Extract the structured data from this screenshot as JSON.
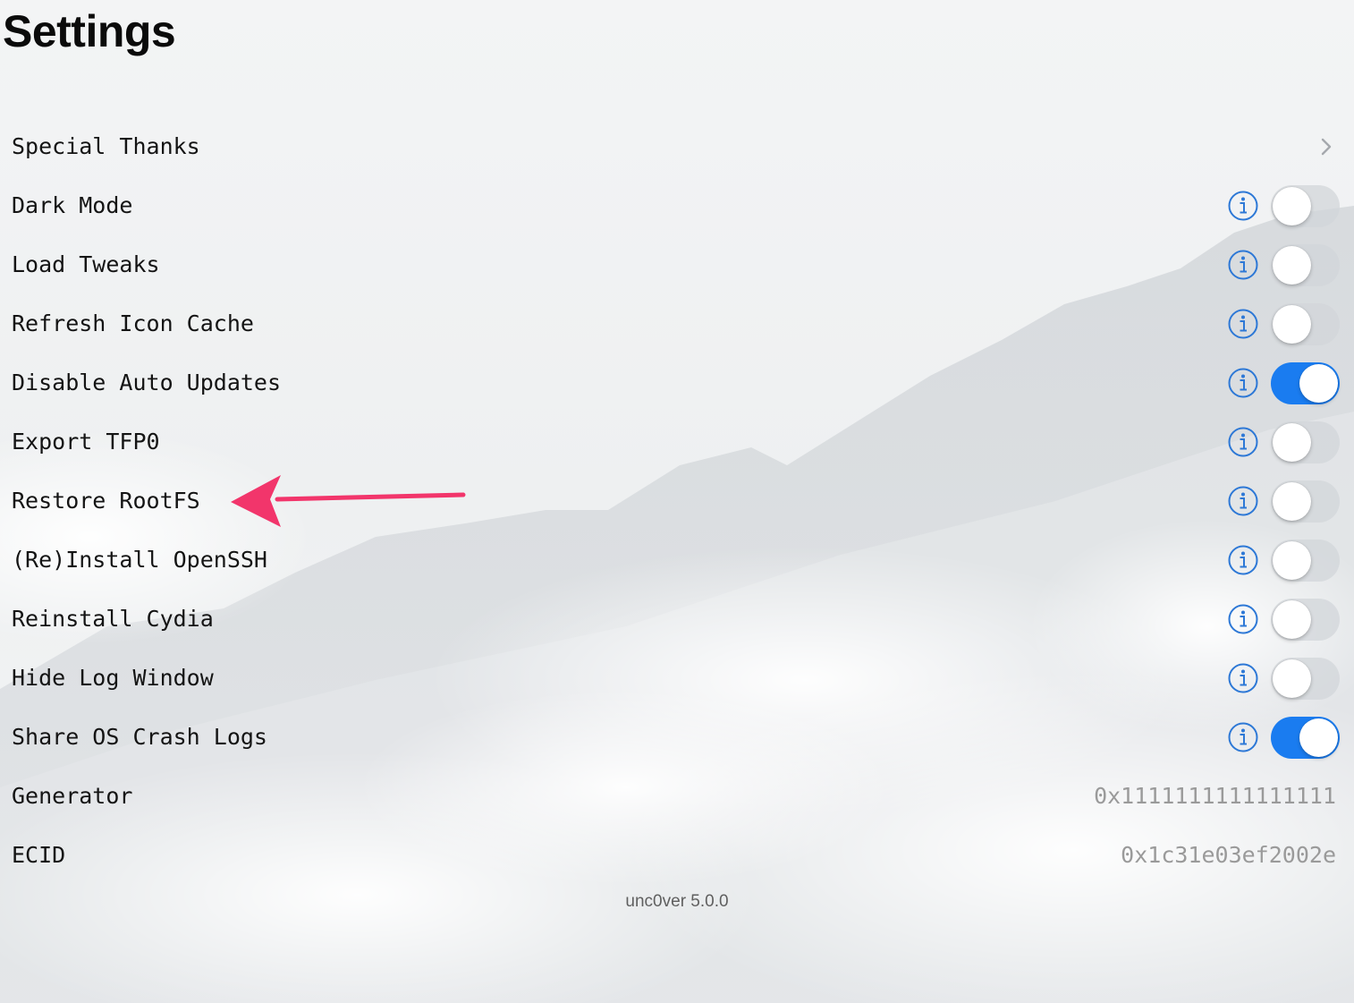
{
  "page": {
    "title": "Settings"
  },
  "settings": {
    "special_thanks": {
      "label": "Special Thanks"
    },
    "toggles": [
      {
        "label": "Dark Mode",
        "on": false
      },
      {
        "label": "Load Tweaks",
        "on": false
      },
      {
        "label": "Refresh Icon Cache",
        "on": false
      },
      {
        "label": "Disable Auto Updates",
        "on": true
      },
      {
        "label": "Export TFP0",
        "on": false
      },
      {
        "label": "Restore RootFS",
        "on": false
      },
      {
        "label": "(Re)Install OpenSSH",
        "on": false
      },
      {
        "label": "Reinstall Cydia",
        "on": false
      },
      {
        "label": "Hide Log Window",
        "on": false
      },
      {
        "label": "Share OS Crash Logs",
        "on": true
      }
    ],
    "generator": {
      "label": "Generator",
      "value": "0x1111111111111111"
    },
    "ecid": {
      "label": "ECID",
      "value": "0x1c31e03ef2002e"
    }
  },
  "footer": {
    "version": "unc0ver 5.0.0"
  },
  "icons": {
    "info": "info-circle-icon",
    "chevron": "chevron-right-icon",
    "annotation": "arrow-left-annotation"
  },
  "colors": {
    "accent": "#1a7cf0",
    "toggle_off": "#d2d5da",
    "annotation": "#f2356b",
    "info": "#2d78d6"
  }
}
